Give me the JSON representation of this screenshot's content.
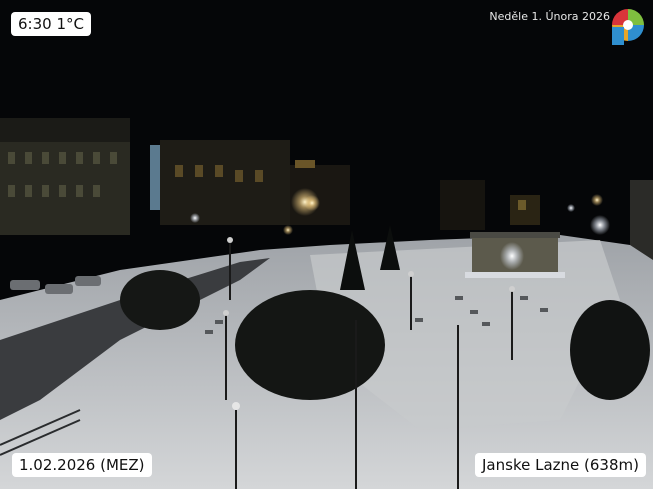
{
  "overlay": {
    "time_temp": "6:30  1°C",
    "date_top": "Neděle   1. Února 2026",
    "date_bottom": "1.02.2026 (MEZ)",
    "location": "Janske Lazne (638m)"
  },
  "logo": {
    "icon": "webcam-logo-icon",
    "colors": [
      "#d9343a",
      "#7fbf3f",
      "#2f8fcf",
      "#e8a62a"
    ]
  },
  "scene": {
    "description_icon": "snowy-town-square-night-icon",
    "snow_color": "#c9ccd0",
    "sky_color": "#050608",
    "light_color": "#ffd98a"
  }
}
